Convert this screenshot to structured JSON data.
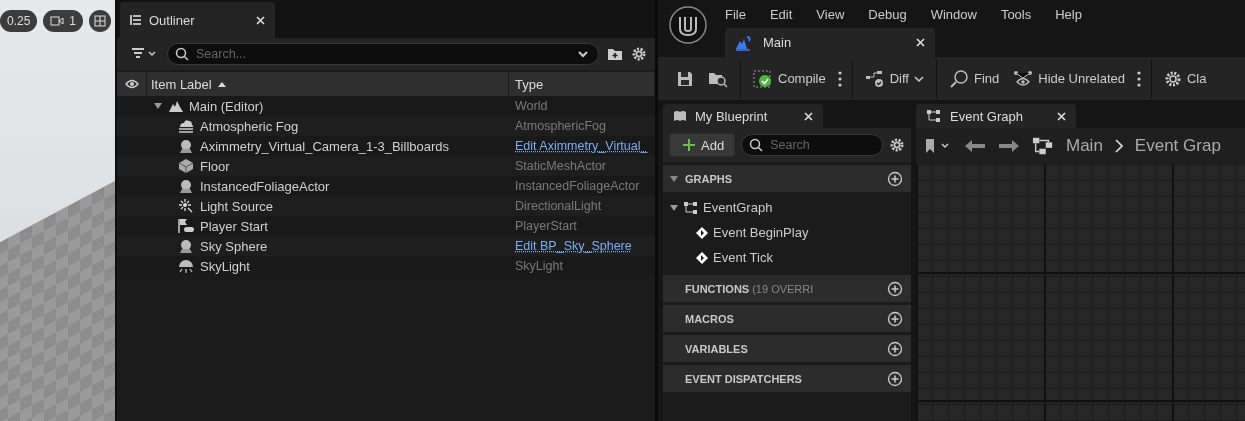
{
  "viewport": {
    "zoom_pill": "0.25",
    "camera_pill": "1"
  },
  "outliner": {
    "tab_title": "Outliner",
    "search": {
      "placeholder": "Search..."
    },
    "columns": [
      "Item Label",
      "Type"
    ],
    "tree": [
      {
        "label": "Main (Editor)",
        "type": "World",
        "link": false,
        "kind": "world",
        "expanded": true,
        "children": [
          {
            "label": "Atmospheric Fog",
            "type": "AtmosphericFog",
            "link": false,
            "kind": "fog"
          },
          {
            "label": "Aximmetry_Virtual_Camera_1-3_Billboards",
            "type": "Edit Aximmetry_Virtual_",
            "link": true,
            "kind": "actor"
          },
          {
            "label": "Floor",
            "type": "StaticMeshActor",
            "link": false,
            "kind": "mesh"
          },
          {
            "label": "InstancedFoliageActor",
            "type": "InstancedFoliageActor",
            "link": false,
            "kind": "actor"
          },
          {
            "label": "Light Source",
            "type": "DirectionalLight",
            "link": false,
            "kind": "light"
          },
          {
            "label": "Player Start",
            "type": "PlayerStart",
            "link": false,
            "kind": "flag"
          },
          {
            "label": "Sky Sphere",
            "type": "Edit BP_Sky_Sphere",
            "link": true,
            "kind": "actor"
          },
          {
            "label": "SkyLight",
            "type": "SkyLight",
            "link": false,
            "kind": "skylight"
          }
        ]
      }
    ]
  },
  "menu": [
    "File",
    "Edit",
    "View",
    "Debug",
    "Window",
    "Tools",
    "Help"
  ],
  "editor_tab": "Main",
  "toolbar": [
    {
      "kind": "save"
    },
    {
      "kind": "browse"
    },
    {
      "kind": "compile",
      "label": "Compile"
    },
    {
      "kind": "diff",
      "label": "Diff"
    },
    {
      "kind": "find",
      "label": "Find"
    },
    {
      "kind": "hide",
      "label": "Hide Unrelated"
    },
    {
      "kind": "settings",
      "label": "Cla"
    }
  ],
  "my_blueprint": {
    "tab_title": "My Blueprint",
    "add_label": "Add",
    "search": {
      "placeholder": "Search"
    },
    "sections": [
      {
        "title": "GRAPHS",
        "expanded": true,
        "items": [
          {
            "label": "EventGraph",
            "kind": "graph",
            "expanded": true,
            "children": [
              {
                "label": "Event BeginPlay",
                "kind": "event"
              },
              {
                "label": "Event Tick",
                "kind": "event"
              }
            ]
          }
        ]
      },
      {
        "title": "FUNCTIONS",
        "note": "(19 OVERRI",
        "expanded": false
      },
      {
        "title": "MACROS",
        "expanded": false
      },
      {
        "title": "VARIABLES",
        "expanded": false
      },
      {
        "title": "EVENT DISPATCHERS",
        "expanded": false
      }
    ]
  },
  "event_graph": {
    "tab_title": "Event Graph",
    "breadcrumb": [
      "Main",
      "Event Grap"
    ]
  }
}
